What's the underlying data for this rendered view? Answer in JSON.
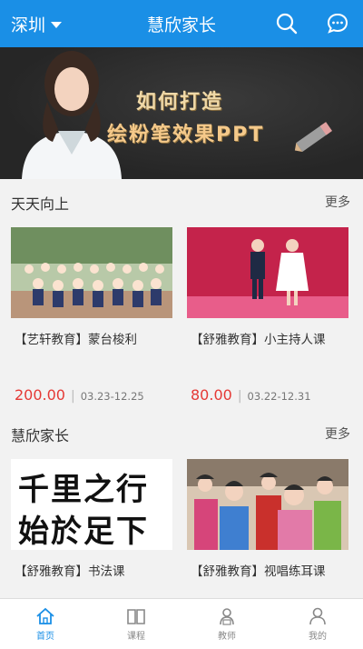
{
  "header": {
    "city": "深圳",
    "title": "慧欣家长"
  },
  "banner": {
    "line1": "如何打造",
    "line2": "绘粉笔效果PPT"
  },
  "section1": {
    "title": "天天向上",
    "more": "更多",
    "items": [
      {
        "name": "【艺轩教育】蒙台梭利",
        "price": "200.00",
        "dates": "03.23-12.25"
      },
      {
        "name": "【舒雅教育】小主持人课",
        "price": "80.00",
        "dates": "03.22-12.31"
      }
    ]
  },
  "section2": {
    "title": "慧欣家长",
    "more": "更多",
    "items": [
      {
        "name": "【舒雅教育】书法课",
        "calligraphy_line1": "千里之行",
        "calligraphy_line2": "始於足下"
      },
      {
        "name": "【舒雅教育】视唱练耳课"
      }
    ]
  },
  "tabs": [
    {
      "label": "首页",
      "icon": "home-icon"
    },
    {
      "label": "课程",
      "icon": "book-icon"
    },
    {
      "label": "教师",
      "icon": "teacher-icon"
    },
    {
      "label": "我的",
      "icon": "profile-icon"
    }
  ],
  "colors": {
    "primary": "#1a8fe6",
    "price": "#e53935"
  }
}
